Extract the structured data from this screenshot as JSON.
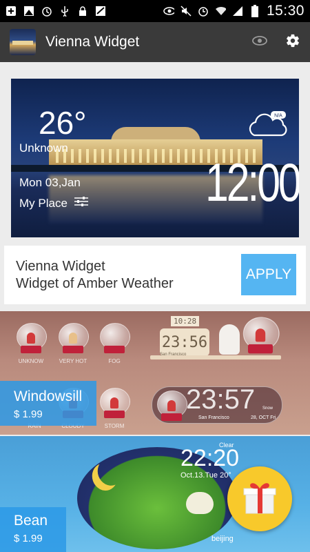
{
  "status_bar": {
    "time": "15:30",
    "icons": [
      "add-icon",
      "image-icon",
      "alarm-icon",
      "usb-icon",
      "lock-icon",
      "weather-icon",
      "eye-icon",
      "mute-icon",
      "alarm-clock-icon",
      "wifi-icon",
      "signal-icon",
      "battery-icon"
    ]
  },
  "appbar": {
    "title": "Vienna Widget",
    "actions": [
      "eye-icon",
      "settings-icon"
    ]
  },
  "preview": {
    "temperature": "26°",
    "condition": "Unknown",
    "date": "Mon 03,Jan",
    "place": "My Place",
    "badge": "N/A",
    "clock": "12:00"
  },
  "info": {
    "title": "Vienna Widget",
    "subtitle": "Widget of Amber Weather",
    "apply_label": "APPLY"
  },
  "themes": [
    {
      "name": "Windowsill",
      "price": "$ 1.99",
      "globe_labels": [
        "UNKNOW",
        "VERY HOT",
        "FOG",
        "RAIN",
        "CLOUDY",
        "STORM"
      ],
      "clock_top": "10:28",
      "clock_main": "23:56",
      "clock_city": "San Francisco",
      "pill_time": "23:57",
      "pill_city": "San Francisco",
      "pill_date": "28, OCT Fri",
      "pill_cond": "Snow"
    },
    {
      "name": "Bean",
      "price": "$ 1.99",
      "time": "22:20",
      "date": "Oct.13.Tue",
      "temp": "20°",
      "city": "beijing",
      "condition": "Clear"
    }
  ],
  "colors": {
    "accent": "#55b5f2",
    "appbar": "#3a3a3a",
    "tag": "#2c99e6",
    "fab": "#f8c92b"
  }
}
